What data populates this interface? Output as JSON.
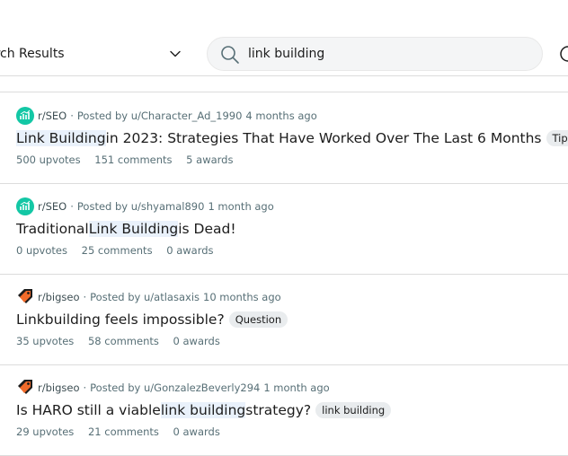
{
  "header": {
    "results_label": "arch Results",
    "search_value": "link building"
  },
  "posts": [
    {
      "subreddit": "r/SEO",
      "posted_by": "Posted by u/Character_Ad_1990",
      "time": "4 months ago",
      "title_pre": "",
      "title_hl": "Link Building",
      "title_post": " in 2023: Strategies That Have Worked Over The Last 6 Months",
      "flair": "Tips",
      "upvotes": "500 upvotes",
      "comments": "151 comments",
      "awards": "5 awards",
      "avatar": "seo-icon"
    },
    {
      "subreddit": "r/SEO",
      "posted_by": "Posted by u/shyamal890",
      "time": "1 month ago",
      "title_pre": "Traditional ",
      "title_hl": "Link Building",
      "title_post": " is Dead!",
      "flair": "",
      "upvotes": "0 upvotes",
      "comments": "25 comments",
      "awards": "0 awards",
      "avatar": "seo-icon"
    },
    {
      "subreddit": "r/bigseo",
      "posted_by": "Posted by u/atlasaxis",
      "time": "10 months ago",
      "title_pre": "Linkbuilding feels impossible?",
      "title_hl": "",
      "title_post": "",
      "flair": "Question",
      "upvotes": "35 upvotes",
      "comments": "58 comments",
      "awards": "0 awards",
      "avatar": "tag-icon"
    },
    {
      "subreddit": "r/bigseo",
      "posted_by": "Posted by u/GonzalezBeverly294",
      "time": "1 month ago",
      "title_pre": "Is HARO still a viable ",
      "title_hl": "link building",
      "title_post": " strategy?",
      "flair": "link building",
      "upvotes": "29 upvotes",
      "comments": "21 comments",
      "awards": "0 awards",
      "avatar": "tag-icon"
    }
  ],
  "colors": {
    "seo_avatar": "#13c7a5",
    "highlight": "#e9f1fb",
    "flair_bg": "#e9ecee",
    "meta_text": "#576f76"
  }
}
